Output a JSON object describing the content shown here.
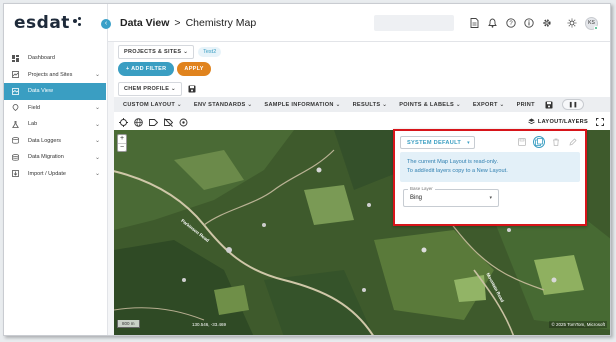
{
  "app": {
    "logo_text": "esdat"
  },
  "sidebar": {
    "items": [
      {
        "label": "Dashboard",
        "icon": "dashboard-icon",
        "has_chevron": false,
        "active": false
      },
      {
        "label": "Projects and Sites",
        "icon": "map-icon",
        "has_chevron": true,
        "active": false
      },
      {
        "label": "Data View",
        "icon": "database-view-icon",
        "has_chevron": false,
        "active": true
      },
      {
        "label": "Field",
        "icon": "field-icon",
        "has_chevron": true,
        "active": false
      },
      {
        "label": "Lab",
        "icon": "flask-icon",
        "has_chevron": true,
        "active": false
      },
      {
        "label": "Data Loggers",
        "icon": "logger-icon",
        "has_chevron": true,
        "active": false
      },
      {
        "label": "Data Migration",
        "icon": "migration-icon",
        "has_chevron": true,
        "active": false
      },
      {
        "label": "Import / Update",
        "icon": "import-icon",
        "has_chevron": true,
        "active": false
      }
    ],
    "chevron": "⌄"
  },
  "header": {
    "crumb_main": "Data View",
    "crumb_sep": ">",
    "crumb_sub": "Chemistry Map",
    "avatar_initials": "KS"
  },
  "toolbar": {
    "projects_sites": "PROJECTS & SITES ⌄",
    "site_chip": "Test2",
    "add_filter": "+ ADD FILTER",
    "apply": "APPLY",
    "chem_profile": "CHEM PROFILE ⌄",
    "menu": [
      "CUSTOM LAYOUT ⌄",
      "ENV STANDARDS ⌄",
      "SAMPLE INFORMATION ⌄",
      "RESULTS ⌄",
      "POINTS & LABELS ⌄",
      "EXPORT ⌄",
      "PRINT"
    ],
    "pause": "❚❚",
    "layout_layers": "LAYOUT/LAYERS"
  },
  "map": {
    "zoom_in": "+",
    "zoom_out": "−",
    "scale_text": "800 m",
    "coords": "130.546, -33.469",
    "attribution": "© 2025 TomTom, Microsoft",
    "road_label": "Parkinson Road",
    "road_label_2": "Mountain Road"
  },
  "layer_panel": {
    "layout_dropdown": "SYSTEM DEFAULT",
    "dropdown_arrow": "▾",
    "info_line1": "The current Map Layout is read-only.",
    "info_line2": "To add/edit layers copy to a New Layout.",
    "base_layer_label": "Base Layer",
    "base_layer_value": "Bing",
    "select_arrow": "▾"
  }
}
